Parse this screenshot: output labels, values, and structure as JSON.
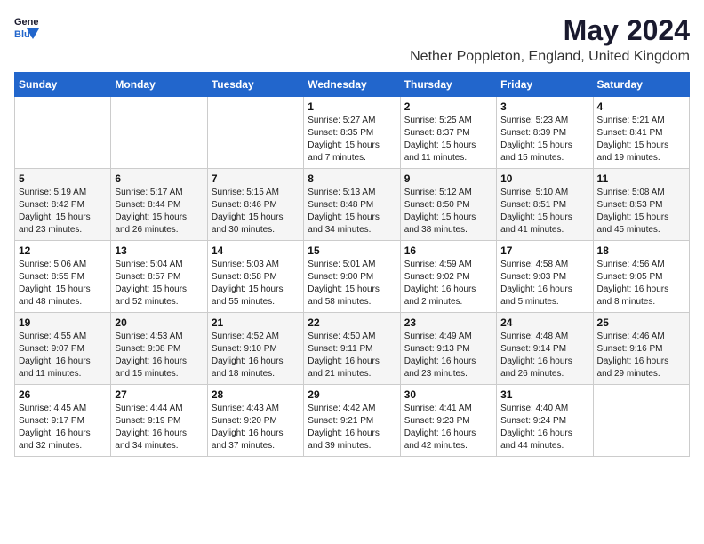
{
  "header": {
    "logo_general": "General",
    "logo_blue": "Blue",
    "title": "May 2024",
    "location": "Nether Poppleton, England, United Kingdom"
  },
  "days_of_week": [
    "Sunday",
    "Monday",
    "Tuesday",
    "Wednesday",
    "Thursday",
    "Friday",
    "Saturday"
  ],
  "weeks": [
    [
      {
        "day": "",
        "sunrise": "",
        "sunset": "",
        "daylight": ""
      },
      {
        "day": "",
        "sunrise": "",
        "sunset": "",
        "daylight": ""
      },
      {
        "day": "",
        "sunrise": "",
        "sunset": "",
        "daylight": ""
      },
      {
        "day": "1",
        "sunrise": "5:27 AM",
        "sunset": "8:35 PM",
        "daylight": "15 hours and 7 minutes."
      },
      {
        "day": "2",
        "sunrise": "5:25 AM",
        "sunset": "8:37 PM",
        "daylight": "15 hours and 11 minutes."
      },
      {
        "day": "3",
        "sunrise": "5:23 AM",
        "sunset": "8:39 PM",
        "daylight": "15 hours and 15 minutes."
      },
      {
        "day": "4",
        "sunrise": "5:21 AM",
        "sunset": "8:41 PM",
        "daylight": "15 hours and 19 minutes."
      }
    ],
    [
      {
        "day": "5",
        "sunrise": "5:19 AM",
        "sunset": "8:42 PM",
        "daylight": "15 hours and 23 minutes."
      },
      {
        "day": "6",
        "sunrise": "5:17 AM",
        "sunset": "8:44 PM",
        "daylight": "15 hours and 26 minutes."
      },
      {
        "day": "7",
        "sunrise": "5:15 AM",
        "sunset": "8:46 PM",
        "daylight": "15 hours and 30 minutes."
      },
      {
        "day": "8",
        "sunrise": "5:13 AM",
        "sunset": "8:48 PM",
        "daylight": "15 hours and 34 minutes."
      },
      {
        "day": "9",
        "sunrise": "5:12 AM",
        "sunset": "8:50 PM",
        "daylight": "15 hours and 38 minutes."
      },
      {
        "day": "10",
        "sunrise": "5:10 AM",
        "sunset": "8:51 PM",
        "daylight": "15 hours and 41 minutes."
      },
      {
        "day": "11",
        "sunrise": "5:08 AM",
        "sunset": "8:53 PM",
        "daylight": "15 hours and 45 minutes."
      }
    ],
    [
      {
        "day": "12",
        "sunrise": "5:06 AM",
        "sunset": "8:55 PM",
        "daylight": "15 hours and 48 minutes."
      },
      {
        "day": "13",
        "sunrise": "5:04 AM",
        "sunset": "8:57 PM",
        "daylight": "15 hours and 52 minutes."
      },
      {
        "day": "14",
        "sunrise": "5:03 AM",
        "sunset": "8:58 PM",
        "daylight": "15 hours and 55 minutes."
      },
      {
        "day": "15",
        "sunrise": "5:01 AM",
        "sunset": "9:00 PM",
        "daylight": "15 hours and 58 minutes."
      },
      {
        "day": "16",
        "sunrise": "4:59 AM",
        "sunset": "9:02 PM",
        "daylight": "16 hours and 2 minutes."
      },
      {
        "day": "17",
        "sunrise": "4:58 AM",
        "sunset": "9:03 PM",
        "daylight": "16 hours and 5 minutes."
      },
      {
        "day": "18",
        "sunrise": "4:56 AM",
        "sunset": "9:05 PM",
        "daylight": "16 hours and 8 minutes."
      }
    ],
    [
      {
        "day": "19",
        "sunrise": "4:55 AM",
        "sunset": "9:07 PM",
        "daylight": "16 hours and 11 minutes."
      },
      {
        "day": "20",
        "sunrise": "4:53 AM",
        "sunset": "9:08 PM",
        "daylight": "16 hours and 15 minutes."
      },
      {
        "day": "21",
        "sunrise": "4:52 AM",
        "sunset": "9:10 PM",
        "daylight": "16 hours and 18 minutes."
      },
      {
        "day": "22",
        "sunrise": "4:50 AM",
        "sunset": "9:11 PM",
        "daylight": "16 hours and 21 minutes."
      },
      {
        "day": "23",
        "sunrise": "4:49 AM",
        "sunset": "9:13 PM",
        "daylight": "16 hours and 23 minutes."
      },
      {
        "day": "24",
        "sunrise": "4:48 AM",
        "sunset": "9:14 PM",
        "daylight": "16 hours and 26 minutes."
      },
      {
        "day": "25",
        "sunrise": "4:46 AM",
        "sunset": "9:16 PM",
        "daylight": "16 hours and 29 minutes."
      }
    ],
    [
      {
        "day": "26",
        "sunrise": "4:45 AM",
        "sunset": "9:17 PM",
        "daylight": "16 hours and 32 minutes."
      },
      {
        "day": "27",
        "sunrise": "4:44 AM",
        "sunset": "9:19 PM",
        "daylight": "16 hours and 34 minutes."
      },
      {
        "day": "28",
        "sunrise": "4:43 AM",
        "sunset": "9:20 PM",
        "daylight": "16 hours and 37 minutes."
      },
      {
        "day": "29",
        "sunrise": "4:42 AM",
        "sunset": "9:21 PM",
        "daylight": "16 hours and 39 minutes."
      },
      {
        "day": "30",
        "sunrise": "4:41 AM",
        "sunset": "9:23 PM",
        "daylight": "16 hours and 42 minutes."
      },
      {
        "day": "31",
        "sunrise": "4:40 AM",
        "sunset": "9:24 PM",
        "daylight": "16 hours and 44 minutes."
      },
      {
        "day": "",
        "sunrise": "",
        "sunset": "",
        "daylight": ""
      }
    ]
  ]
}
